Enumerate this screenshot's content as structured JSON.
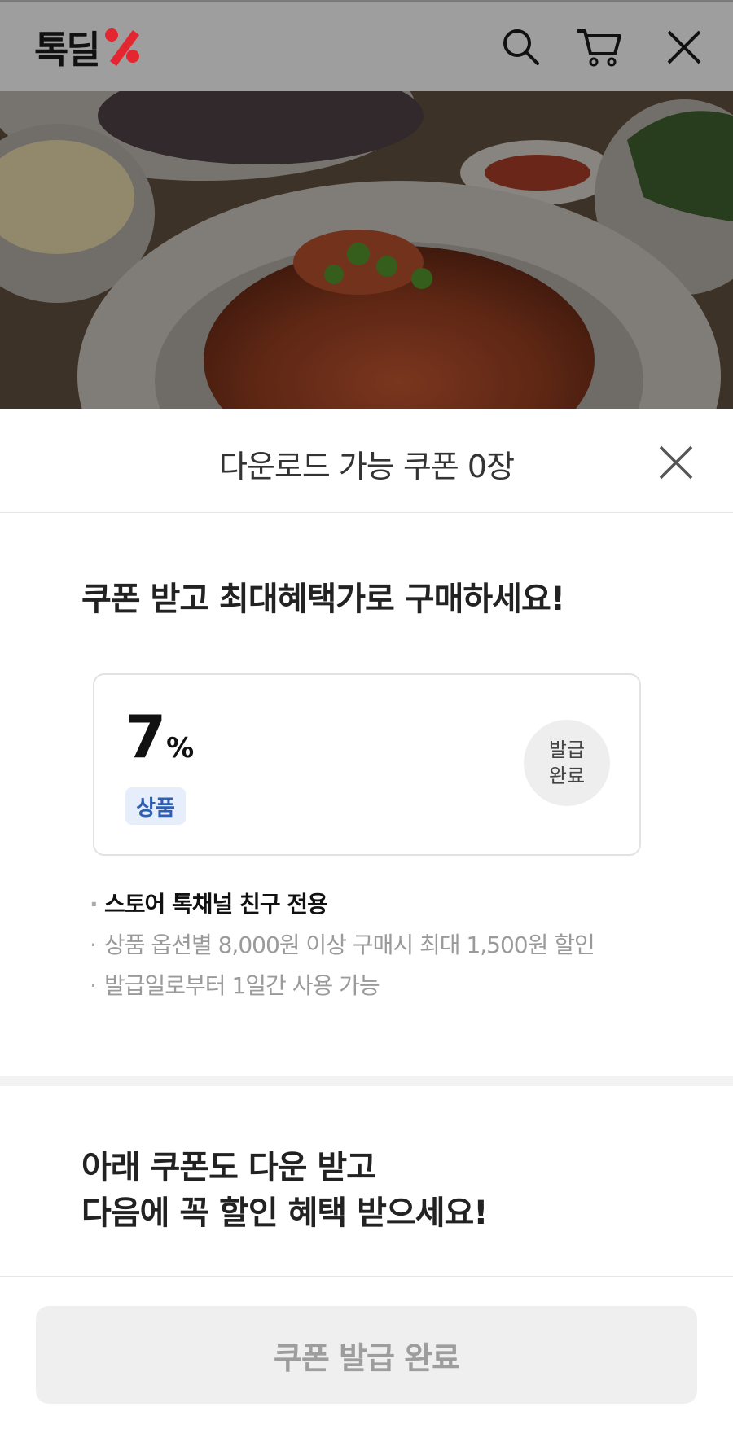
{
  "header": {
    "logo_text": "톡딜",
    "logo_mark": "percent-mark-icon",
    "accent_color": "#e3262f",
    "icons": [
      "search-icon",
      "cart-icon",
      "close-icon"
    ]
  },
  "sheet": {
    "title": "다운로드 가능 쿠폰 0장",
    "section1_title": "쿠폰 받고 최대혜택가로 구매하세요!",
    "coupon": {
      "rate": "7",
      "unit": "%",
      "tag": "상품",
      "status_line1": "발급",
      "status_line2": "완료",
      "conditions": [
        "스토어 톡채널 친구 전용",
        "상품 옵션별 8,000원 이상 구매시 최대 1,500원 할인",
        "발급일로부터 1일간 사용 가능"
      ]
    },
    "section2_title_line1": "아래 쿠폰도 다운 받고",
    "section2_title_line2": "다음에 꼭 할인 혜택 받으세요!",
    "button_label": "쿠폰 발급 완료"
  }
}
